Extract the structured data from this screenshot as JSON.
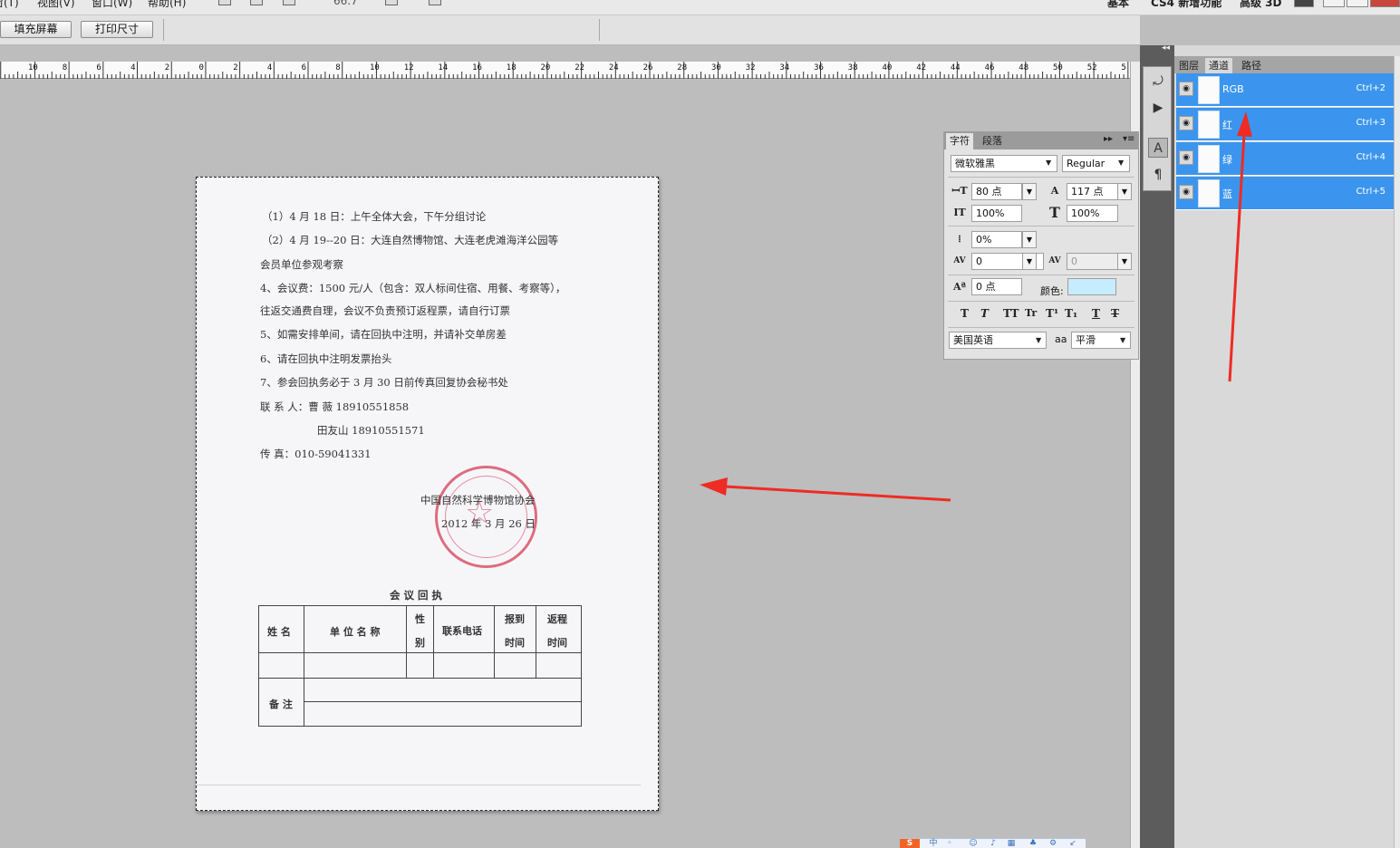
{
  "menubar": {
    "items": [
      "窗(T)",
      "视图(V)",
      "窗口(W)",
      "帮助(H)"
    ],
    "zoom": "66.7",
    "workspaces": [
      "基本",
      "CS4 新增功能",
      "高级 3D"
    ]
  },
  "options": {
    "fill_screen": "填充屏幕",
    "print_size": "打印尺寸"
  },
  "ruler": {
    "labels": [
      "10",
      "8",
      "6",
      "4",
      "2",
      "0",
      "2",
      "4",
      "6",
      "8",
      "10",
      "12",
      "14",
      "16",
      "18",
      "20",
      "22",
      "24",
      "26",
      "28",
      "30",
      "32",
      "34",
      "36",
      "38",
      "40",
      "42",
      "44",
      "46",
      "48",
      "50",
      "52",
      "5"
    ]
  },
  "document": {
    "lines": [
      "（1）4 月 18 日：上午全体大会，下午分组讨论",
      "（2）4 月 19--20 日：大连自然博物馆、大连老虎滩海洋公园等",
      "会员单位参观考察",
      "4、会议费：1500 元/人（包含：双人标间住宿、用餐、考察等），",
      "往返交通费自理，会议不负责预订返程票，请自行订票",
      "5、如需安排单间，请在回执中注明，并请补交单房差",
      "6、请在回执中注明发票抬头",
      "7、参会回执务必于 3 月 30 日前传真回复协会秘书处",
      "联  系  人：曹    薇  18910551858",
      "田友山  18910551571",
      "传        真：010-59041331"
    ],
    "org": "中国自然科学博物馆协会",
    "date": "2012 年 3 月 26 日",
    "receipt_title": "会 议 回 执",
    "table_headers": [
      "姓 名",
      "单 位 名 称",
      "性",
      "别",
      "联系电话",
      "报到",
      "时间",
      "返程",
      "时间"
    ],
    "remarks": "备 注"
  },
  "character_panel": {
    "tab_char": "字符",
    "tab_para": "段落",
    "font_family": "微软雅黑",
    "font_style": "Regular",
    "font_size": "80 点",
    "leading": "117 点",
    "vscale": "100%",
    "hscale": "100%",
    "tsume": "0%",
    "kerning": "0",
    "tracking": "0",
    "baseline": "0 点",
    "color_label": "颜色:",
    "color": "#c6ecff",
    "language": "美国英语",
    "antialias": "平滑",
    "aa_icon": "aa"
  },
  "channels_panel": {
    "tabs": [
      "图层",
      "通道",
      "路径"
    ],
    "channels": [
      {
        "name": "RGB",
        "shortcut": "Ctrl+2"
      },
      {
        "name": "红",
        "shortcut": "Ctrl+3"
      },
      {
        "name": "绿",
        "shortcut": "Ctrl+4"
      },
      {
        "name": "蓝",
        "shortcut": "Ctrl+5"
      }
    ],
    "selected_color": "#3b95ee"
  },
  "colors": {
    "arrow": "#ee2b24",
    "stamp": "#d9556a"
  }
}
